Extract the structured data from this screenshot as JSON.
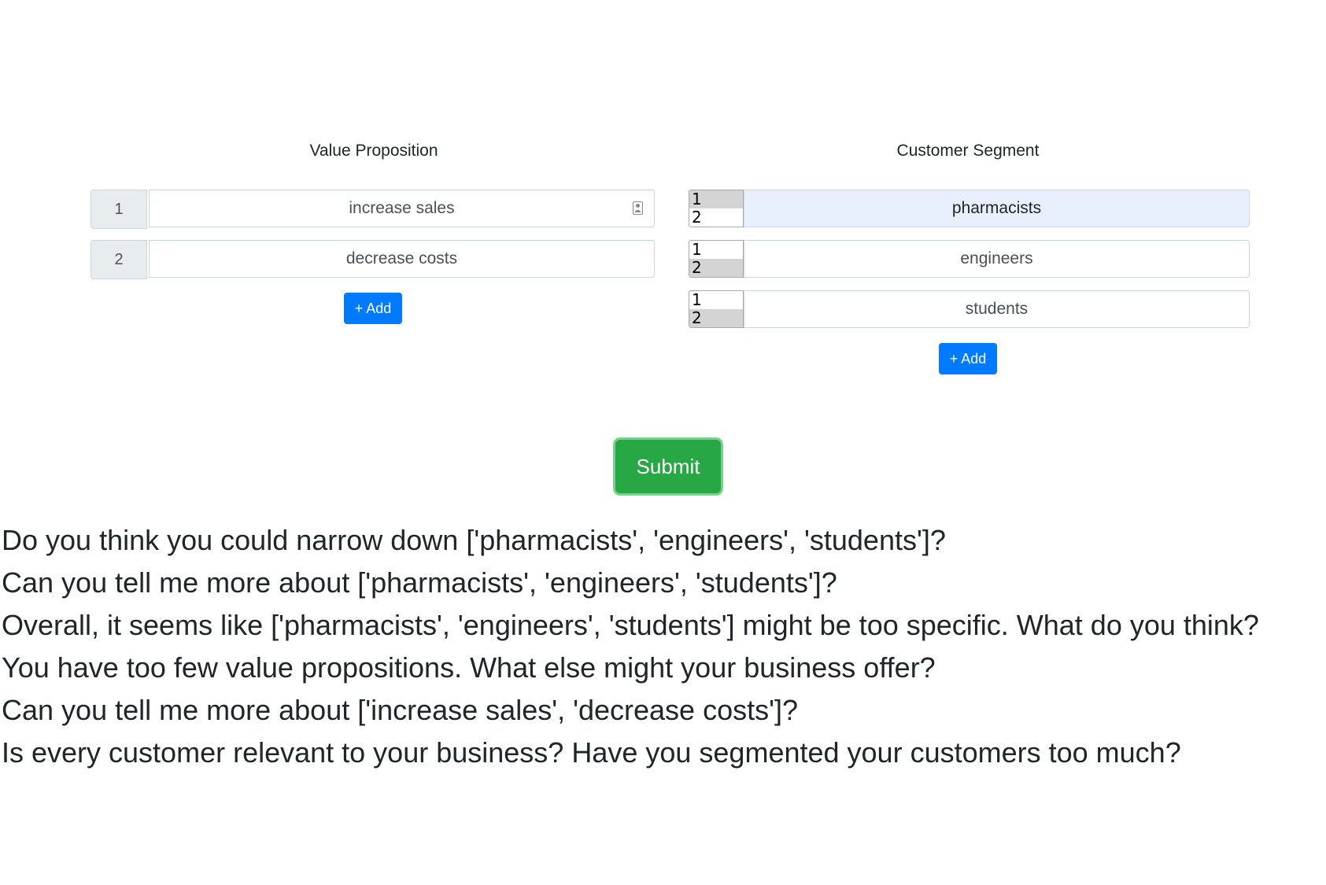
{
  "value_proposition": {
    "title": "Value Proposition",
    "rows": [
      {
        "number": "1",
        "text": "increase sales"
      },
      {
        "number": "2",
        "text": "decrease costs"
      }
    ],
    "add_label": "+ Add"
  },
  "customer_segment": {
    "title": "Customer Segment",
    "rows": [
      {
        "options": [
          "1",
          "2"
        ],
        "selected": "1",
        "text": "pharmacists"
      },
      {
        "options": [
          "1",
          "2"
        ],
        "selected": "2",
        "text": "engineers"
      },
      {
        "options": [
          "1",
          "2"
        ],
        "selected": "2",
        "text": "students"
      }
    ],
    "add_label": "+ Add"
  },
  "submit_label": "Submit",
  "feedback": [
    "Do you think you could narrow down ['pharmacists', 'engineers', 'students']?",
    "Can you tell me more about ['pharmacists', 'engineers', 'students']?",
    "Overall, it seems like ['pharmacists', 'engineers', 'students'] might be too specific. What do you think?",
    "You have too few value propositions. What else might your business offer?",
    "Can you tell me more about ['increase sales', 'decrease costs']?",
    "Is every customer relevant to your business? Have you segmented your customers too much?"
  ],
  "colors": {
    "add_button": "#007bff",
    "submit_button": "#28a745",
    "focused_input": "#e8f0fe"
  }
}
